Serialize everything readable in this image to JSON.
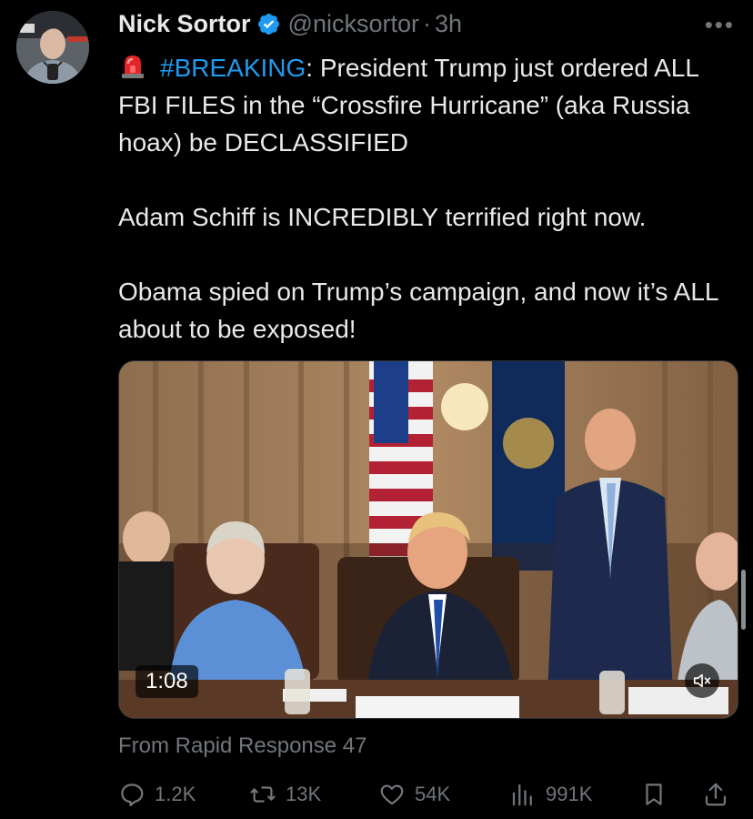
{
  "author": {
    "display_name": "Nick Sortor",
    "handle": "@nicksortor",
    "separator": "·",
    "time": "3h",
    "verified_icon": "verified-badge-icon",
    "verified_color": "#1d9bf0"
  },
  "tweet": {
    "hashtag": "#BREAKING",
    "line1_rest": ": President Trump just ordered ALL FBI FILES in the “Crossfire Hurricane” (aka Russia hoax) be DECLASSIFIED",
    "paragraph2": "Adam Schiff is INCREDIBLY terrified right now.",
    "paragraph3": "Obama spied on Trump’s campaign, and now it’s ALL about to be exposed!",
    "siren_icon": "siren-icon"
  },
  "media": {
    "duration": "1:08",
    "mute_icon": "volume-muted-icon"
  },
  "source": {
    "text": "From Rapid Response 47"
  },
  "actions": {
    "replies": "1.2K",
    "reposts": "13K",
    "likes": "54K",
    "views": "991K",
    "reply_icon": "reply-icon",
    "repost_icon": "repost-icon",
    "like_icon": "heart-icon",
    "views_icon": "views-chart-icon",
    "bookmark_icon": "bookmark-icon",
    "share_icon": "share-icon"
  },
  "colors": {
    "background": "#000000",
    "text": "#e7e9ea",
    "muted": "#71767b",
    "accent": "#1d9bf0"
  }
}
